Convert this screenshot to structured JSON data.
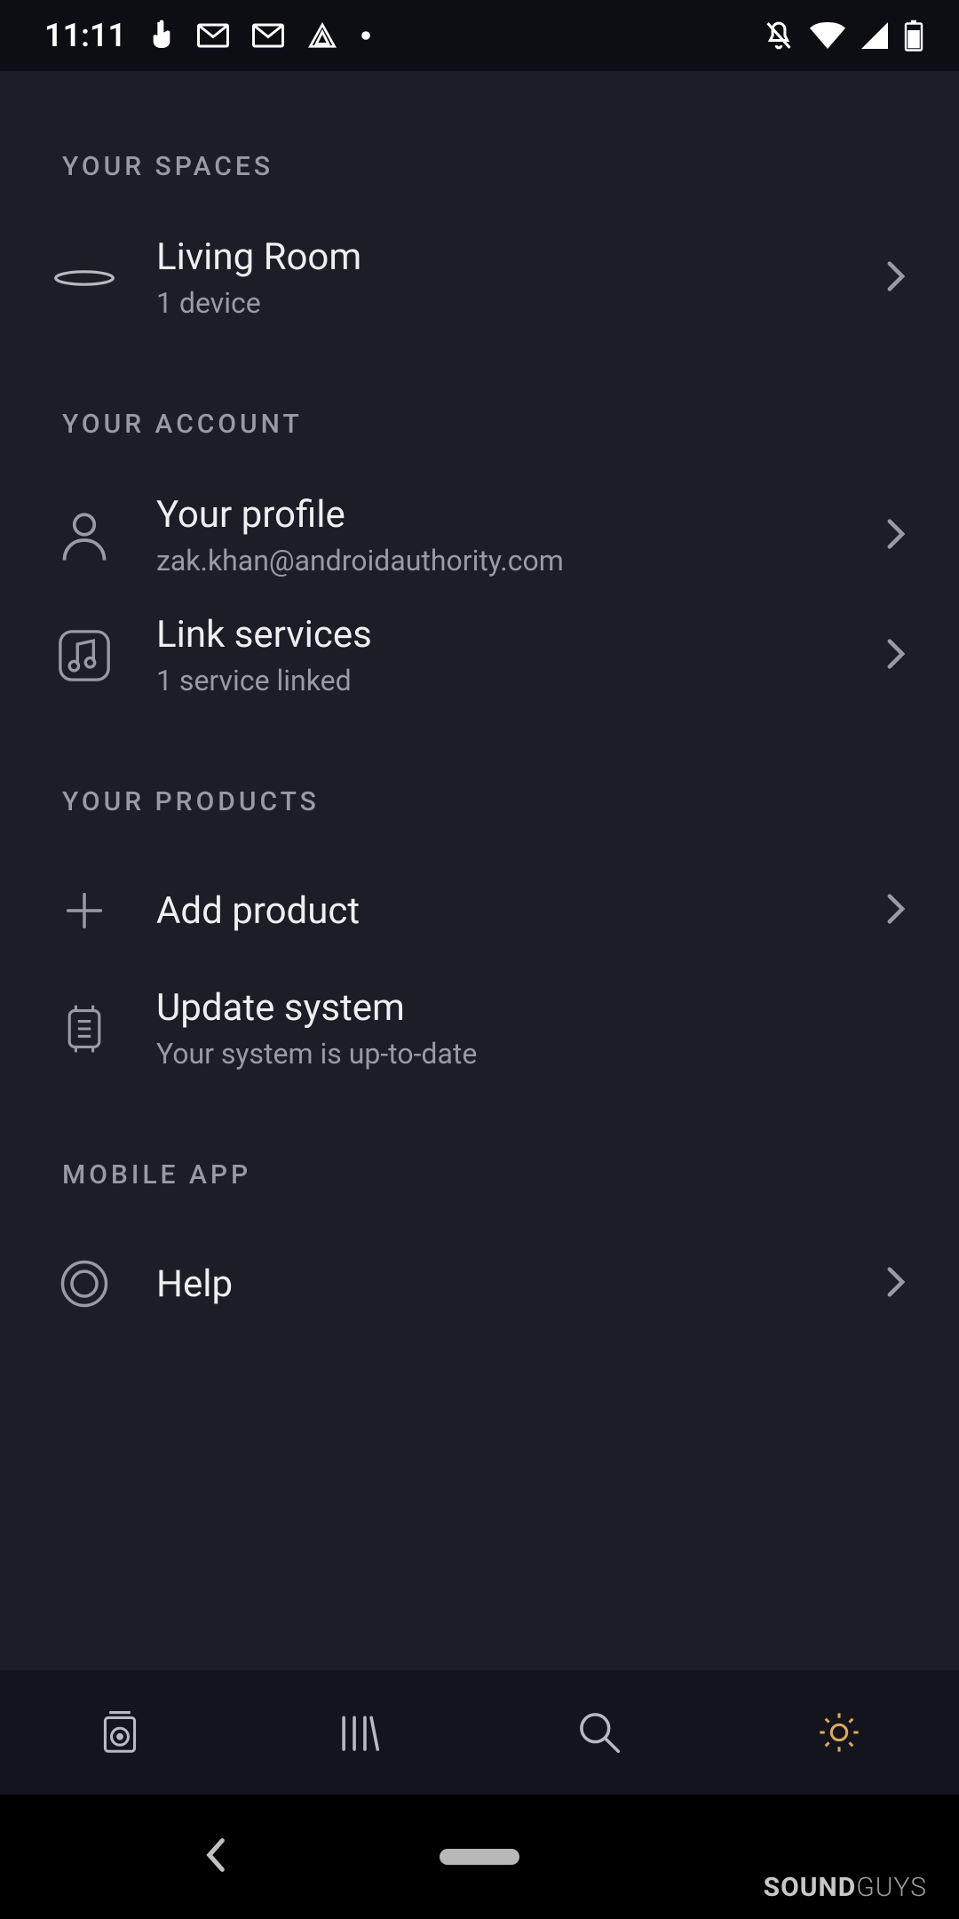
{
  "status": {
    "time": "11:11"
  },
  "sections": {
    "spaces": {
      "header": "Your Spaces",
      "item0": {
        "title": "Living Room",
        "sub": "1 device"
      }
    },
    "account": {
      "header": "Your Account",
      "item0": {
        "title": "Your profile",
        "sub": "zak.khan@androidauthority.com"
      },
      "item1": {
        "title": "Link services",
        "sub": "1 service linked"
      }
    },
    "products": {
      "header": "Your Products",
      "item0": {
        "title": "Add product"
      },
      "item1": {
        "title": "Update system",
        "sub": "Your system is up-to-date"
      }
    },
    "mobile": {
      "header": "Mobile App",
      "item0": {
        "title": "Help"
      }
    }
  },
  "watermark": {
    "bold": "SOUND",
    "light": "GUYS"
  }
}
